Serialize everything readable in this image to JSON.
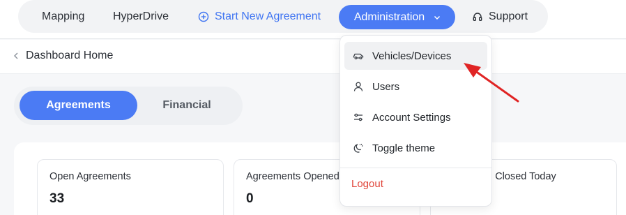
{
  "topnav": {
    "items": [
      {
        "label": "Mapping"
      },
      {
        "label": "HyperDrive"
      },
      {
        "label": "Start New Agreement",
        "icon": "plus-circle-icon"
      },
      {
        "label": "Administration",
        "icon": "chevron-down-icon",
        "active": true
      },
      {
        "label": "Support",
        "icon": "headset-icon"
      }
    ]
  },
  "breadcrumb": {
    "label": "Dashboard Home",
    "icon": "chevron-left-icon"
  },
  "tabs": [
    {
      "label": "Agreements",
      "active": true
    },
    {
      "label": "Financial"
    }
  ],
  "cards": [
    {
      "title": "Open Agreements",
      "value": "33"
    },
    {
      "title": "Agreements Opened Today",
      "value": "0"
    },
    {
      "title": "Agreements Closed Today"
    }
  ],
  "dropdown": {
    "items": [
      {
        "label": "Vehicles/Devices",
        "icon": "car-icon",
        "highlighted": true
      },
      {
        "label": "Users",
        "icon": "user-icon"
      },
      {
        "label": "Account Settings",
        "icon": "sliders-icon"
      },
      {
        "label": "Toggle theme",
        "icon": "theme-toggle-icon"
      }
    ],
    "logout_label": "Logout"
  },
  "colors": {
    "accent": "#4b7bf4",
    "link": "#3f74f2",
    "logout": "#e0453a",
    "annotation": "#e02424"
  }
}
